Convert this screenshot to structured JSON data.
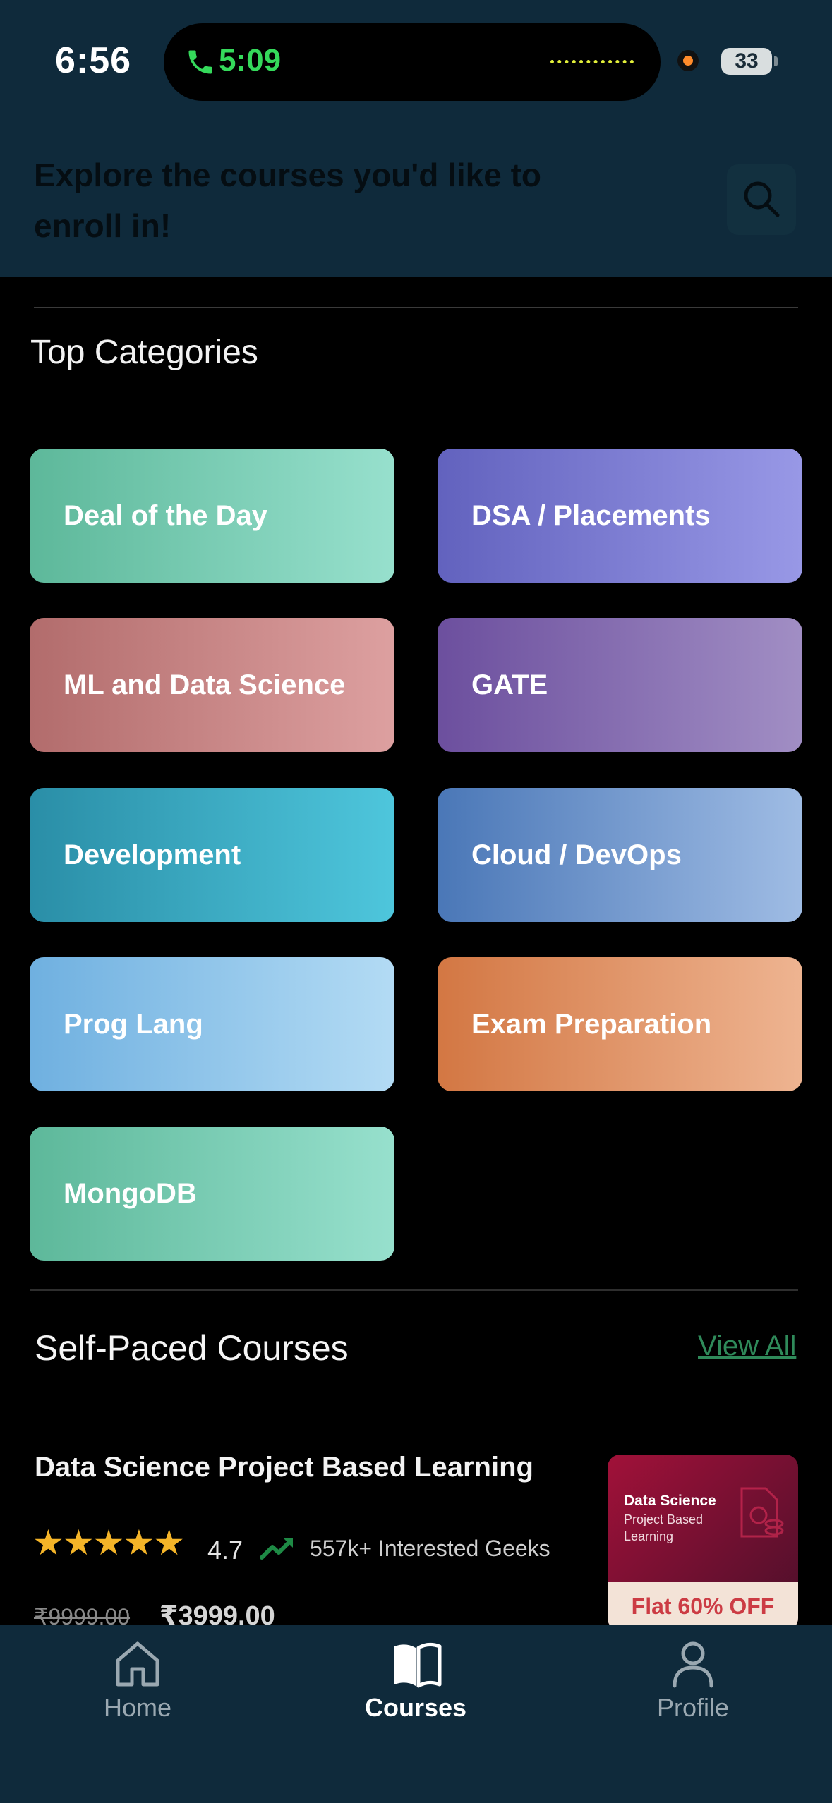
{
  "status_bar": {
    "time": "6:56",
    "call_time": "5:09",
    "battery": "33"
  },
  "header": {
    "heading": "Explore the courses you'd like to enroll in!",
    "search_icon": "search-icon"
  },
  "top_categories": {
    "title": "Top Categories",
    "items": [
      {
        "label": "Deal of the Day",
        "color_start": "#5db89a",
        "color_end": "#97e0cd"
      },
      {
        "label": "DSA / Placements",
        "color_start": "#6262be",
        "color_end": "#9898e6"
      },
      {
        "label": "ML and Data Science",
        "color_start": "#b26c6c",
        "color_end": "#dda0a0"
      },
      {
        "label": "GATE",
        "color_start": "#6c4f9e",
        "color_end": "#a18ec4"
      },
      {
        "label": "Development",
        "color_start": "#2a8ea7",
        "color_end": "#4ec6dc"
      },
      {
        "label": "Cloud / DevOps",
        "color_start": "#4a77b7",
        "color_end": "#9fbce4"
      },
      {
        "label": "Prog Lang",
        "color_start": "#6fb0e0",
        "color_end": "#b3dbf4"
      },
      {
        "label": "Exam Preparation",
        "color_start": "#d37743",
        "color_end": "#eeb491"
      },
      {
        "label": "MongoDB",
        "color_start": "#5db89a",
        "color_end": "#97e0cd"
      }
    ]
  },
  "self_paced": {
    "title": "Self-Paced Courses",
    "view_all": "View All",
    "course": {
      "title": "Data Science Project Based Learning",
      "stars": "★★★★★",
      "rating": "4.7",
      "interested": "557k+ Interested Geeks",
      "old_price": "₹9999.00",
      "new_price": "₹3999.00",
      "thumbnail": {
        "title": "Data Science",
        "subtitle": "Project Based Learning",
        "badge": "Flat 60% OFF"
      }
    }
  },
  "bottom_nav": {
    "items": [
      {
        "label": "Home",
        "icon": "home-icon",
        "active": false
      },
      {
        "label": "Courses",
        "icon": "book-icon",
        "active": true
      },
      {
        "label": "Profile",
        "icon": "person-icon",
        "active": false
      }
    ]
  },
  "colors": {
    "header_bg": "#0f2a3b",
    "page_bg": "#000000",
    "link_green": "#2f8a5a",
    "star_gold": "#f4b428",
    "badge_red": "#cc3c44"
  }
}
